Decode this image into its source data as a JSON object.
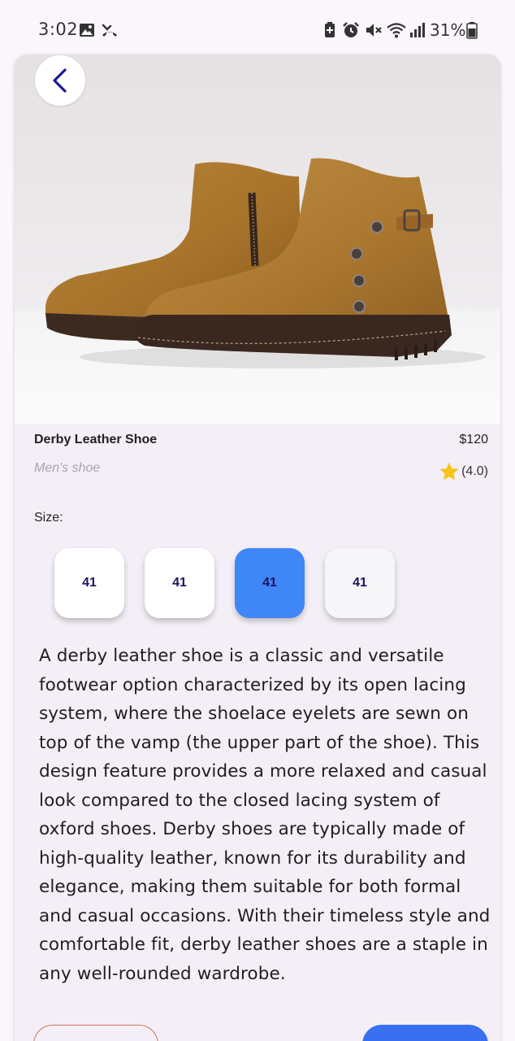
{
  "status_bar": {
    "time": "3:02",
    "battery": "31%",
    "icons": [
      "gallery-icon",
      "missed-call-icon",
      "battery-saver-icon",
      "alarm-icon",
      "mute-icon",
      "wifi-icon",
      "signal-icon",
      "battery-icon"
    ]
  },
  "product": {
    "name": "Derby Leather Shoe",
    "price": "$120",
    "category": "Men's shoe",
    "rating": "(4.0)",
    "image": "brown-leather-boot-photo"
  },
  "size": {
    "label": "Size:",
    "options": [
      "41",
      "41",
      "41",
      "41"
    ],
    "selected_index": 2
  },
  "description": "A derby leather shoe is a classic and versatile footwear option characterized by its open lacing system, where the shoelace eyelets are sewn on top of the vamp (the upper part of the shoe). This design feature provides a more relaxed and casual look compared to the closed lacing system of oxford shoes. Derby shoes are typically made of high-quality leather, known for its durability and elegance, making them suitable for both formal and casual occasions. With their timeless style and comfortable fit, derby leather shoes are a staple in any well-rounded wardrobe.",
  "colors": {
    "accent": "#3f86f7",
    "back_arrow": "#1c1a8c",
    "star": "#f5c518",
    "size_text": "#1c1460",
    "outline_button": "#d2735c",
    "primary_button": "#3a6ff1"
  }
}
